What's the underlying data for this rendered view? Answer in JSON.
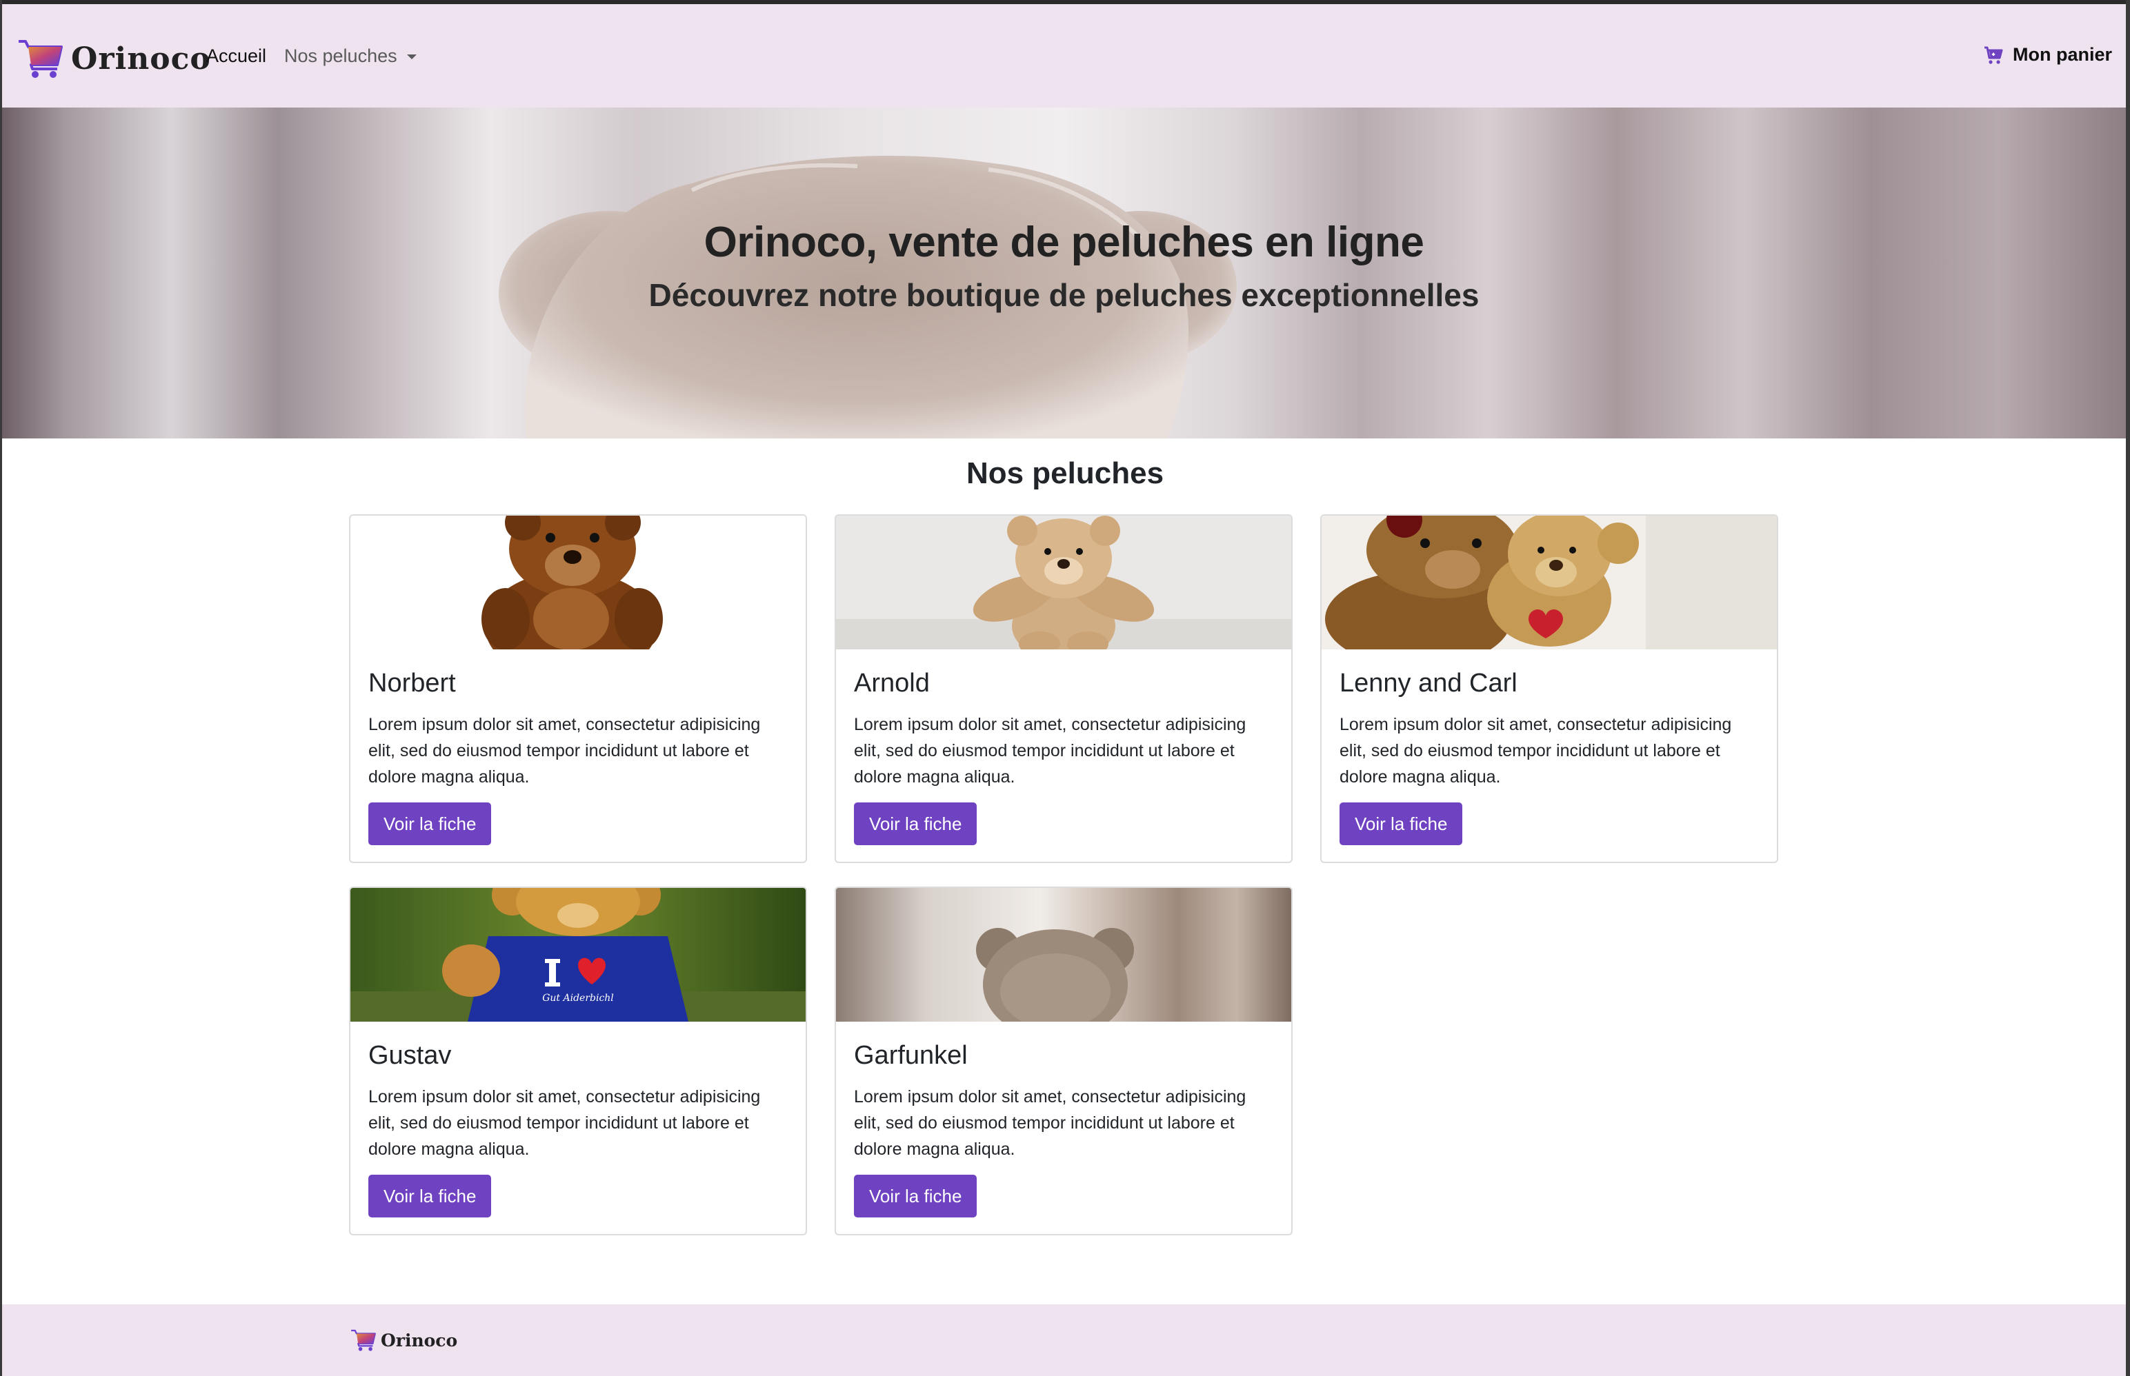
{
  "navbar": {
    "brand": "Orinoco",
    "home_label": "Accueil",
    "products_label": "Nos peluches",
    "cart_label": "Mon panier"
  },
  "hero": {
    "title": "Orinoco, vente de peluches en ligne",
    "subtitle": "Découvrez notre boutique de peluches exceptionnelles"
  },
  "section_title": "Nos peluches",
  "products": [
    {
      "name": "Norbert",
      "description": "Lorem ipsum dolor sit amet, consectetur adipisicing elit, sed do eiusmod tempor incididunt ut labore et dolore magna aliqua.",
      "button_label": "Voir la fiche"
    },
    {
      "name": "Arnold",
      "description": "Lorem ipsum dolor sit amet, consectetur adipisicing elit, sed do eiusmod tempor incididunt ut labore et dolore magna aliqua.",
      "button_label": "Voir la fiche"
    },
    {
      "name": "Lenny and Carl",
      "description": "Lorem ipsum dolor sit amet, consectetur adipisicing elit, sed do eiusmod tempor incididunt ut labore et dolore magna aliqua.",
      "button_label": "Voir la fiche"
    },
    {
      "name": "Gustav",
      "description": "Lorem ipsum dolor sit amet, consectetur adipisicing elit, sed do eiusmod tempor incididunt ut labore et dolore magna aliqua.",
      "button_label": "Voir la fiche",
      "shirt_text": "I",
      "shirt_script": "Gut Aiderbichl"
    },
    {
      "name": "Garfunkel",
      "description": "Lorem ipsum dolor sit amet, consectetur adipisicing elit, sed do eiusmod tempor incididunt ut labore et dolore magna aliqua.",
      "button_label": "Voir la fiche"
    }
  ],
  "footer": {
    "brand": "Orinoco"
  },
  "colors": {
    "accent": "#6f42c1",
    "navbar_bg": "#efe3ef",
    "cart_icon": "#6f42c1"
  },
  "icons": {
    "logo": "shopping-cart-gradient-icon",
    "dropdown": "caret-down-icon",
    "cart": "shopping-cart-icon"
  }
}
